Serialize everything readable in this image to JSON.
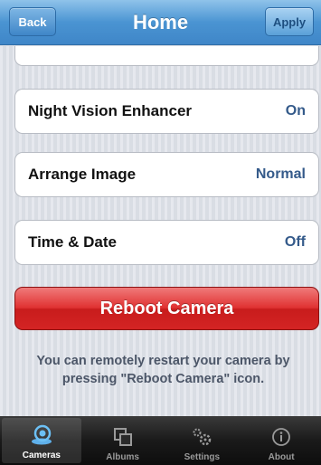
{
  "nav": {
    "back_label": "Back",
    "title": "Home",
    "apply_label": "Apply"
  },
  "settings": {
    "partial_label": "",
    "rows": [
      {
        "label": "Night Vision Enhancer",
        "value": "On"
      },
      {
        "label": "Arrange Image",
        "value": "Normal"
      },
      {
        "label": "Time & Date",
        "value": "Off"
      }
    ]
  },
  "reboot": {
    "label": "Reboot Camera",
    "hint": "You can remotely restart your camera by pressing \"Reboot Camera\" icon."
  },
  "tabs": [
    {
      "label": "Cameras",
      "icon": "camera-icon",
      "active": true
    },
    {
      "label": "Albums",
      "icon": "albums-icon",
      "active": false
    },
    {
      "label": "Settings",
      "icon": "gears-icon",
      "active": false
    },
    {
      "label": "About",
      "icon": "info-icon",
      "active": false
    }
  ],
  "colors": {
    "nav_blue": "#4a94d2",
    "reboot_red": "#e03232",
    "value_blue": "#345a8a"
  }
}
